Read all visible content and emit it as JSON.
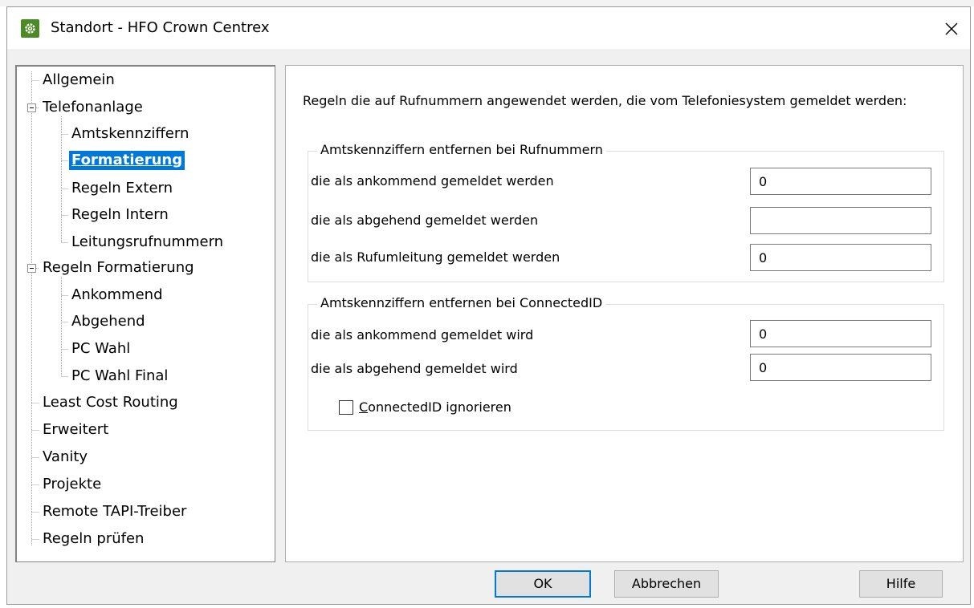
{
  "window": {
    "title": "Standort - HFO Crown Centrex"
  },
  "tree": {
    "items": [
      {
        "label": "Allgemein"
      },
      {
        "label": "Telefonanlage"
      },
      {
        "label": "Amtskennziffern"
      },
      {
        "label": "Formatierung",
        "selected": true
      },
      {
        "label": "Regeln Extern"
      },
      {
        "label": "Regeln Intern"
      },
      {
        "label": "Leitungsrufnummern"
      },
      {
        "label": "Regeln Formatierung"
      },
      {
        "label": "Ankommend"
      },
      {
        "label": "Abgehend"
      },
      {
        "label": "PC Wahl"
      },
      {
        "label": "PC Wahl Final"
      },
      {
        "label": "Least Cost Routing"
      },
      {
        "label": "Erweitert"
      },
      {
        "label": "Vanity"
      },
      {
        "label": "Projekte"
      },
      {
        "label": "Remote TAPI-Treiber"
      },
      {
        "label": "Regeln prüfen"
      }
    ]
  },
  "content": {
    "intro": "Regeln die auf Rufnummern angewendet werden, die vom Telefoniesystem gemeldet werden:",
    "group1": {
      "title": "Amtskennziffern entfernen bei Rufnummern",
      "fields": [
        {
          "label": "die als ankommend gemeldet werden",
          "value": "0"
        },
        {
          "label": "die als abgehend gemeldet werden",
          "value": ""
        },
        {
          "label": "die als Rufumleitung gemeldet werden",
          "value": "0"
        }
      ]
    },
    "group2": {
      "title": "Amtskennziffern entfernen bei ConnectedID",
      "fields": [
        {
          "label": "die als ankommend gemeldet wird",
          "value": "0"
        },
        {
          "label": "die als abgehend gemeldet wird",
          "value": "0"
        }
      ],
      "checkbox": {
        "mnemonic": "C",
        "rest": "onnectedID ignorieren",
        "checked": false
      }
    }
  },
  "buttons": {
    "ok": "OK",
    "cancel": "Abbrechen",
    "help": "Hilfe"
  },
  "colors": {
    "selection": "#0078d7",
    "app_icon": "#4c8a26",
    "dialog_bg": "#f0f0f0"
  }
}
